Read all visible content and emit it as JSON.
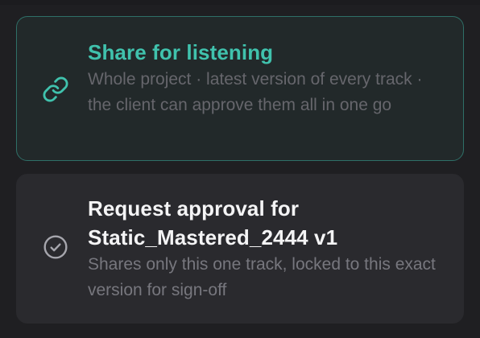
{
  "options": [
    {
      "title": "Share for listening",
      "description": "Whole project · latest version of every track · the client can approve them all in one go",
      "icon": "link-icon",
      "selected": true,
      "accent_color": "#40c2ad"
    },
    {
      "title": "Request approval for Static_Mastered_2444 v1",
      "description": "Shares only this one track, locked to this exact version for sign-off",
      "icon": "check-circle-icon",
      "selected": false
    }
  ]
}
